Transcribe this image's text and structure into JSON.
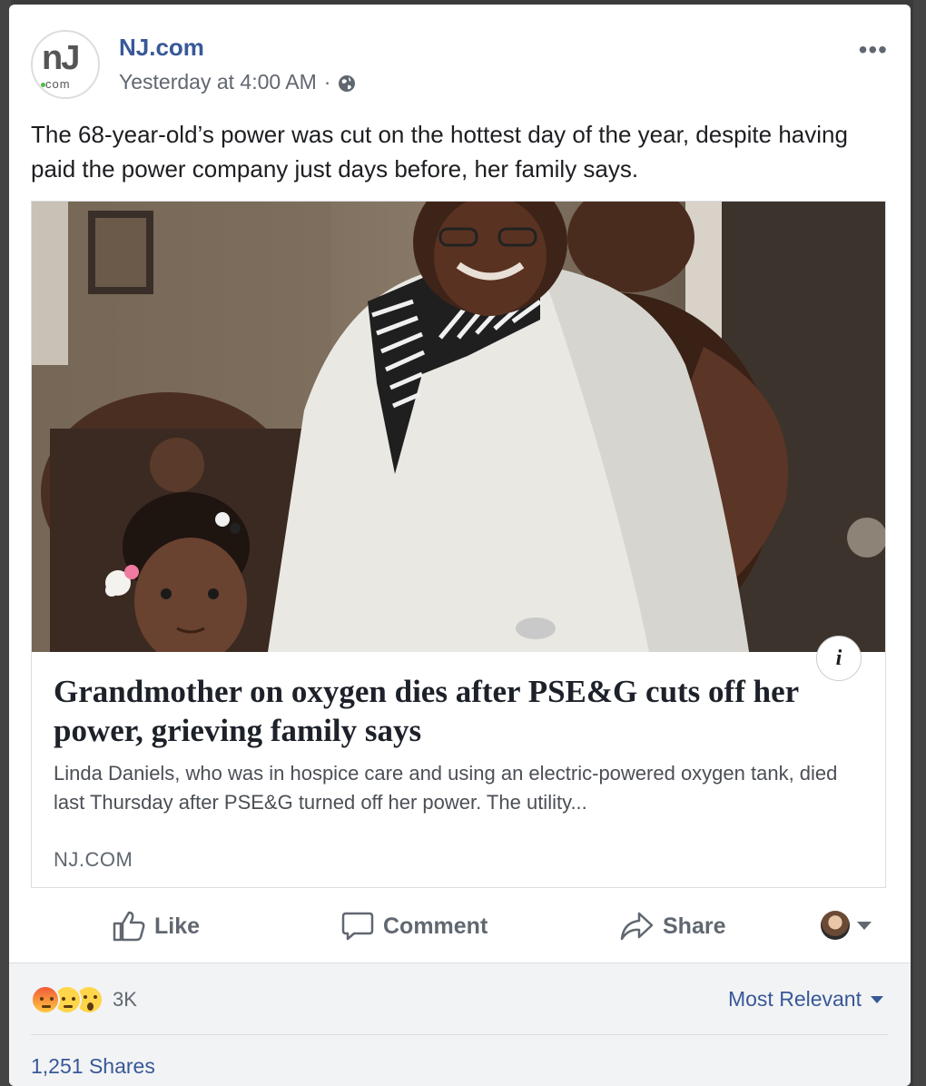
{
  "post": {
    "page_name": "NJ.com",
    "timestamp": "Yesterday at 4:00 AM",
    "separator": "·",
    "avatar_text": "nJ",
    "avatar_subtext": "com",
    "more_label": "•••",
    "text": "The 68-year-old’s power was cut on the hottest day of the year, despite having paid the power company just days before, her family says."
  },
  "link_preview": {
    "info_label": "i",
    "headline": "Grandmother on oxygen dies after PSE&G cuts off her power, grieving family says",
    "summary": "Linda Daniels, who was in hospice care and using an electric-powered oxygen tank, died last Thursday after PSE&G turned off her power. The utility...",
    "domain": "NJ.COM"
  },
  "actions": {
    "like": "Like",
    "comment": "Comment",
    "share": "Share"
  },
  "footer": {
    "reaction_icons": [
      "angry-icon",
      "sad-icon",
      "wow-icon"
    ],
    "reaction_count": "3K",
    "sort_label": "Most Relevant",
    "shares": "1,251 Shares"
  },
  "colors": {
    "link_blue": "#385898",
    "secondary_text": "#606770",
    "footer_bg": "#f2f3f5"
  }
}
